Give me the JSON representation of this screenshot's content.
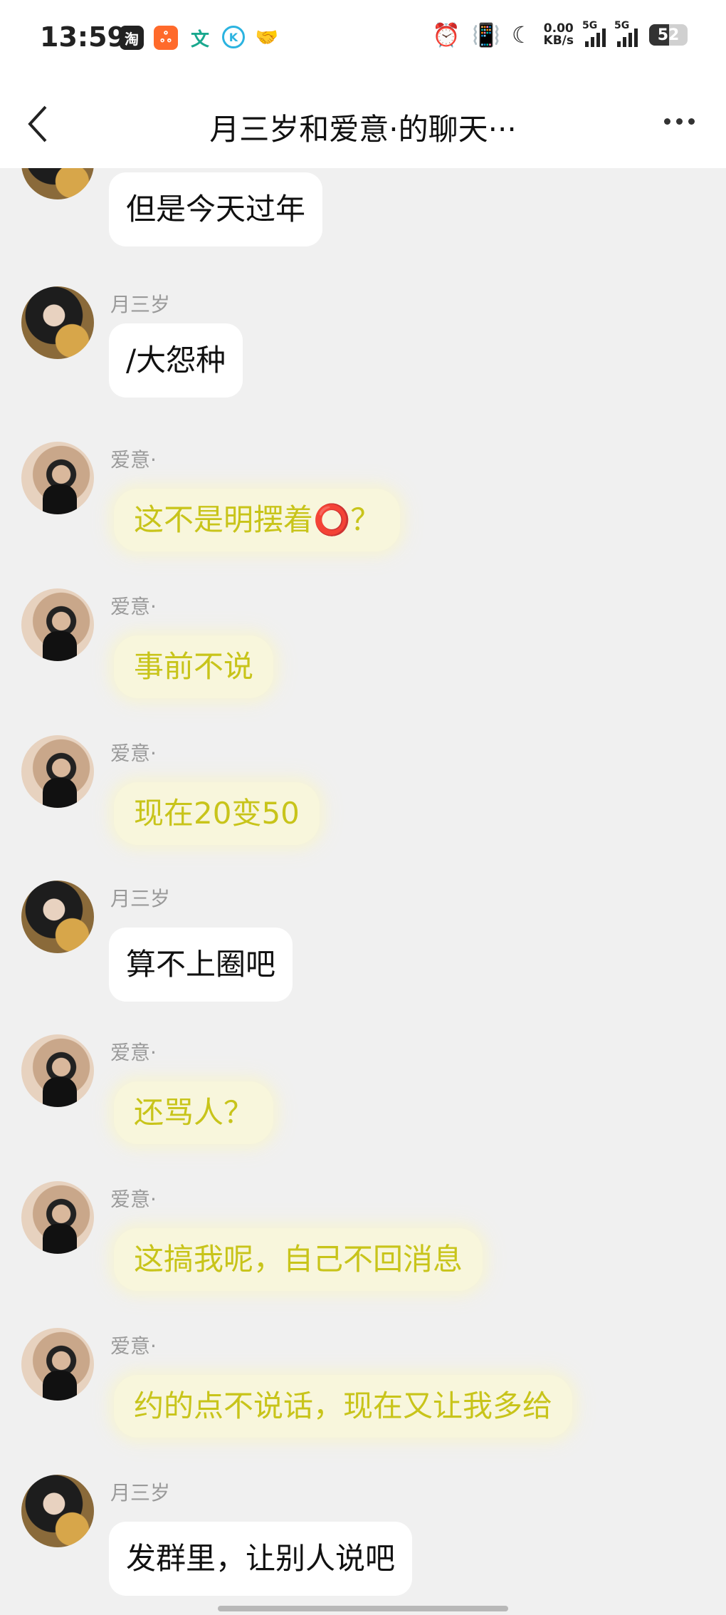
{
  "status_bar": {
    "time": "13:59",
    "app_icons": [
      {
        "name": "taobao-icon",
        "glyph": "淘"
      },
      {
        "name": "app-orange-icon",
        "glyph": "ஃ"
      },
      {
        "name": "wen-icon",
        "glyph": "文"
      },
      {
        "name": "k-icon",
        "glyph": "K"
      },
      {
        "name": "handshake-icon",
        "glyph": "🤝"
      }
    ],
    "speed_value": "0.00",
    "speed_unit": "KB/s",
    "network_1": "5G",
    "network_2": "5G",
    "battery": "52"
  },
  "nav": {
    "title": "月三岁和爱意·的聊天···"
  },
  "messages": [
    {
      "sender": "",
      "avatar": "yue",
      "text": "但是今天过年",
      "style": "plain"
    },
    {
      "sender": "月三岁",
      "avatar": "yue",
      "text": "/大怨种",
      "style": "plain"
    },
    {
      "sender": "爱意·",
      "avatar": "ai",
      "text": "这不是明摆着⭕？",
      "style": "fancy"
    },
    {
      "sender": "爱意·",
      "avatar": "ai",
      "text": "事前不说",
      "style": "fancy"
    },
    {
      "sender": "爱意·",
      "avatar": "ai",
      "text": "现在20变50",
      "style": "fancy"
    },
    {
      "sender": "月三岁",
      "avatar": "yue",
      "text": "算不上圈吧",
      "style": "plain"
    },
    {
      "sender": "爱意·",
      "avatar": "ai",
      "text": "还骂人？",
      "style": "fancy"
    },
    {
      "sender": "爱意·",
      "avatar": "ai",
      "text": "这搞我呢，自己不回消息",
      "style": "fancy"
    },
    {
      "sender": "爱意·",
      "avatar": "ai",
      "text": "约的点不说话，现在又让我多给",
      "style": "fancy"
    },
    {
      "sender": "月三岁",
      "avatar": "yue",
      "text": "发群里，让别人说吧",
      "style": "plain"
    }
  ],
  "colors": {
    "background": "#f0f0f0",
    "plain_bubble": "#ffffff",
    "fancy_bubble_text": "#c8c41a",
    "sender_text": "#9a9a9a"
  }
}
